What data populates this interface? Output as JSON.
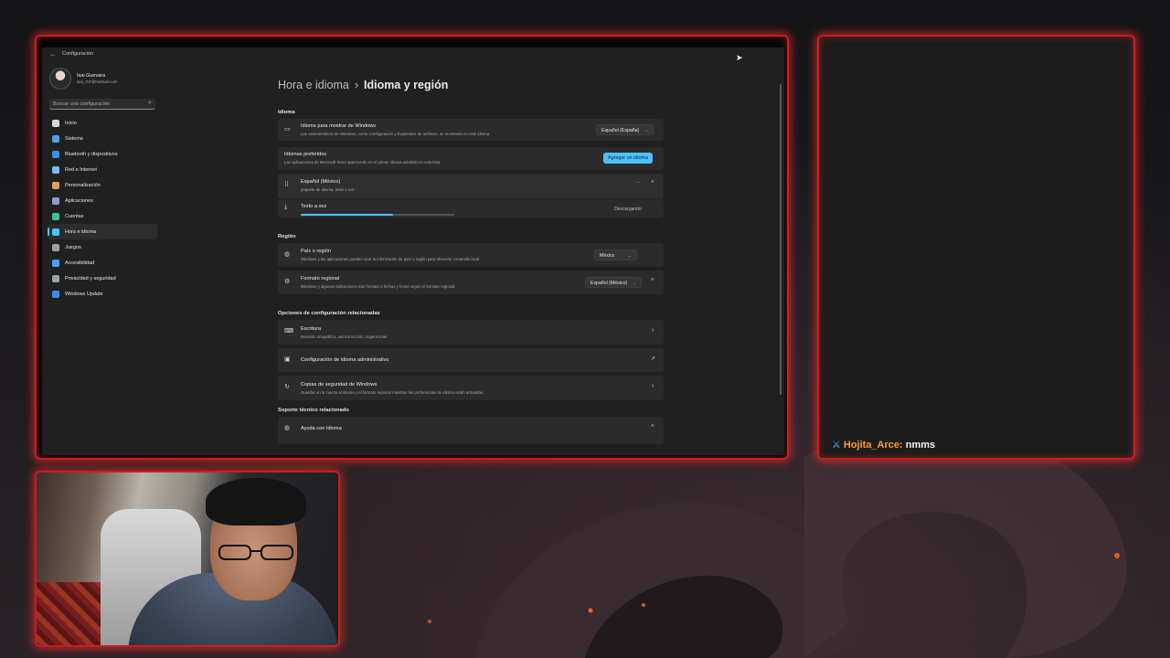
{
  "window": {
    "app_title": "Configuración",
    "back_icon": "back-arrow-icon"
  },
  "profile": {
    "name": "Isai Guevara",
    "email": "isai_Grr@hotmail.com"
  },
  "search": {
    "placeholder": "Buscar una configuración",
    "icon": "search-icon"
  },
  "sidebar": {
    "items": [
      {
        "label": "Inicio",
        "icon": "home-icon",
        "color": "#d9d9d9"
      },
      {
        "label": "Sistema",
        "icon": "system-icon",
        "color": "#4c9ff0"
      },
      {
        "label": "Bluetooth y dispositivos",
        "icon": "bluetooth-icon",
        "color": "#3a8ee6"
      },
      {
        "label": "Red e Internet",
        "icon": "wifi-icon",
        "color": "#7ab8ff"
      },
      {
        "label": "Personalización",
        "icon": "brush-icon",
        "color": "#e0a060"
      },
      {
        "label": "Aplicaciones",
        "icon": "apps-icon",
        "color": "#8aa0c8"
      },
      {
        "label": "Cuentas",
        "icon": "accounts-icon",
        "color": "#3ec28f"
      },
      {
        "label": "Hora e idioma",
        "icon": "time-language-icon",
        "color": "#4cc2ff"
      },
      {
        "label": "Juegos",
        "icon": "gaming-icon",
        "color": "#a0a0a0"
      },
      {
        "label": "Accesibilidad",
        "icon": "accessibility-icon",
        "color": "#4a9eff"
      },
      {
        "label": "Privacidad y seguridad",
        "icon": "shield-icon",
        "color": "#9aa0a8"
      },
      {
        "label": "Windows Update",
        "icon": "update-icon",
        "color": "#3a8ee6"
      }
    ],
    "active_index": 7
  },
  "breadcrumb": {
    "parent": "Hora e idioma",
    "separator": "›",
    "current": "Idioma y región"
  },
  "sections": {
    "idioma": "Idioma",
    "region": "Región",
    "related": "Opciones de configuración relacionadas",
    "support": "Soporte técnico relacionado"
  },
  "display_language": {
    "title": "Idioma para mostrar de Windows",
    "subtitle": "Las características de Windows, como Configuración y Explorador de archivos, se mostrarán en este idioma.",
    "value": "Español (España)",
    "icon": "monitor-icon"
  },
  "preferred": {
    "title": "Idiomas preferidos",
    "subtitle": "Las aplicaciones de Microsoft Store aparecerán en el primer idioma admitido en esta lista",
    "button": "Agregar un idioma"
  },
  "language_item": {
    "title": "Español (México)",
    "subtitle": "paquete de idioma, texto a voz",
    "more": "···",
    "drag_icon": "drag-handle-icon"
  },
  "download": {
    "title": "Texto a voz",
    "status": "Descargando",
    "progress_percent": 60,
    "icon": "download-icon"
  },
  "country": {
    "title": "País o región",
    "subtitle": "Windows y las aplicaciones pueden usar tu información de país o región para ofrecerte contenido local",
    "value": "México",
    "icon": "globe-icon"
  },
  "regional_format": {
    "title": "Formato regional",
    "subtitle": "Windows y algunas aplicaciones dan formato a fechas y horas según el formato regional.",
    "value": "Español (México)",
    "icon": "regional-format-icon"
  },
  "related": [
    {
      "title": "Escritura",
      "subtitle": "Revisión ortográfica, autocorrección, sugerencias",
      "icon": "keyboard-icon",
      "action": "›"
    },
    {
      "title": "Configuración de idioma administrativo",
      "subtitle": "",
      "icon": "admin-language-icon",
      "action": "↗"
    },
    {
      "title": "Copias de seguridad de Windows",
      "subtitle": "Guardar en la cuenta el idioma y el formato regional mientras las preferencias de idioma están activadas.",
      "icon": "backup-icon",
      "action": "›"
    }
  ],
  "support": {
    "title": "Ayuda con Idioma",
    "icon": "globe-icon"
  },
  "chat": {
    "badge_icon": "sword-badge-icon",
    "user": "Hojita_Arce:",
    "message": "nmms"
  },
  "colors": {
    "frame_glow": "#c81e1e",
    "accent": "#4cc2ff",
    "chat_user": "#ff9b2e"
  }
}
